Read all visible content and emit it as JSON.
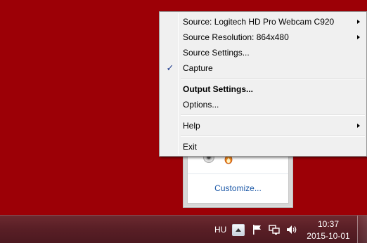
{
  "menu": {
    "items": [
      {
        "label": "Source: Logitech HD Pro Webcam C920",
        "submenu": true,
        "checked": false,
        "bold": false
      },
      {
        "label": "Source Resolution: 864x480",
        "submenu": true,
        "checked": false,
        "bold": false
      },
      {
        "label": "Source Settings...",
        "submenu": false,
        "checked": false,
        "bold": false
      },
      {
        "label": "Capture",
        "submenu": false,
        "checked": true,
        "bold": false
      },
      {
        "label": "Output Settings...",
        "submenu": false,
        "checked": false,
        "bold": true
      },
      {
        "label": "Options...",
        "submenu": false,
        "checked": false,
        "bold": false
      },
      {
        "label": "Help",
        "submenu": true,
        "checked": false,
        "bold": false
      },
      {
        "label": "Exit",
        "submenu": false,
        "checked": false,
        "bold": false
      }
    ],
    "check_glyph": "✓"
  },
  "flyout": {
    "customize_label": "Customize...",
    "icons": [
      "webcam-lens-icon",
      "flame-app-icon"
    ]
  },
  "taskbar": {
    "language": "HU",
    "time": "10:37",
    "date": "2015-10-01",
    "icons": [
      "show-hidden-icons-arrow",
      "action-center-flag-icon",
      "network-icon",
      "volume-icon"
    ]
  },
  "colors": {
    "desktop": "#9c0006",
    "taskbar": "#5a1f26",
    "menu_bg": "#f0f0f0",
    "link": "#1e5aa8"
  }
}
